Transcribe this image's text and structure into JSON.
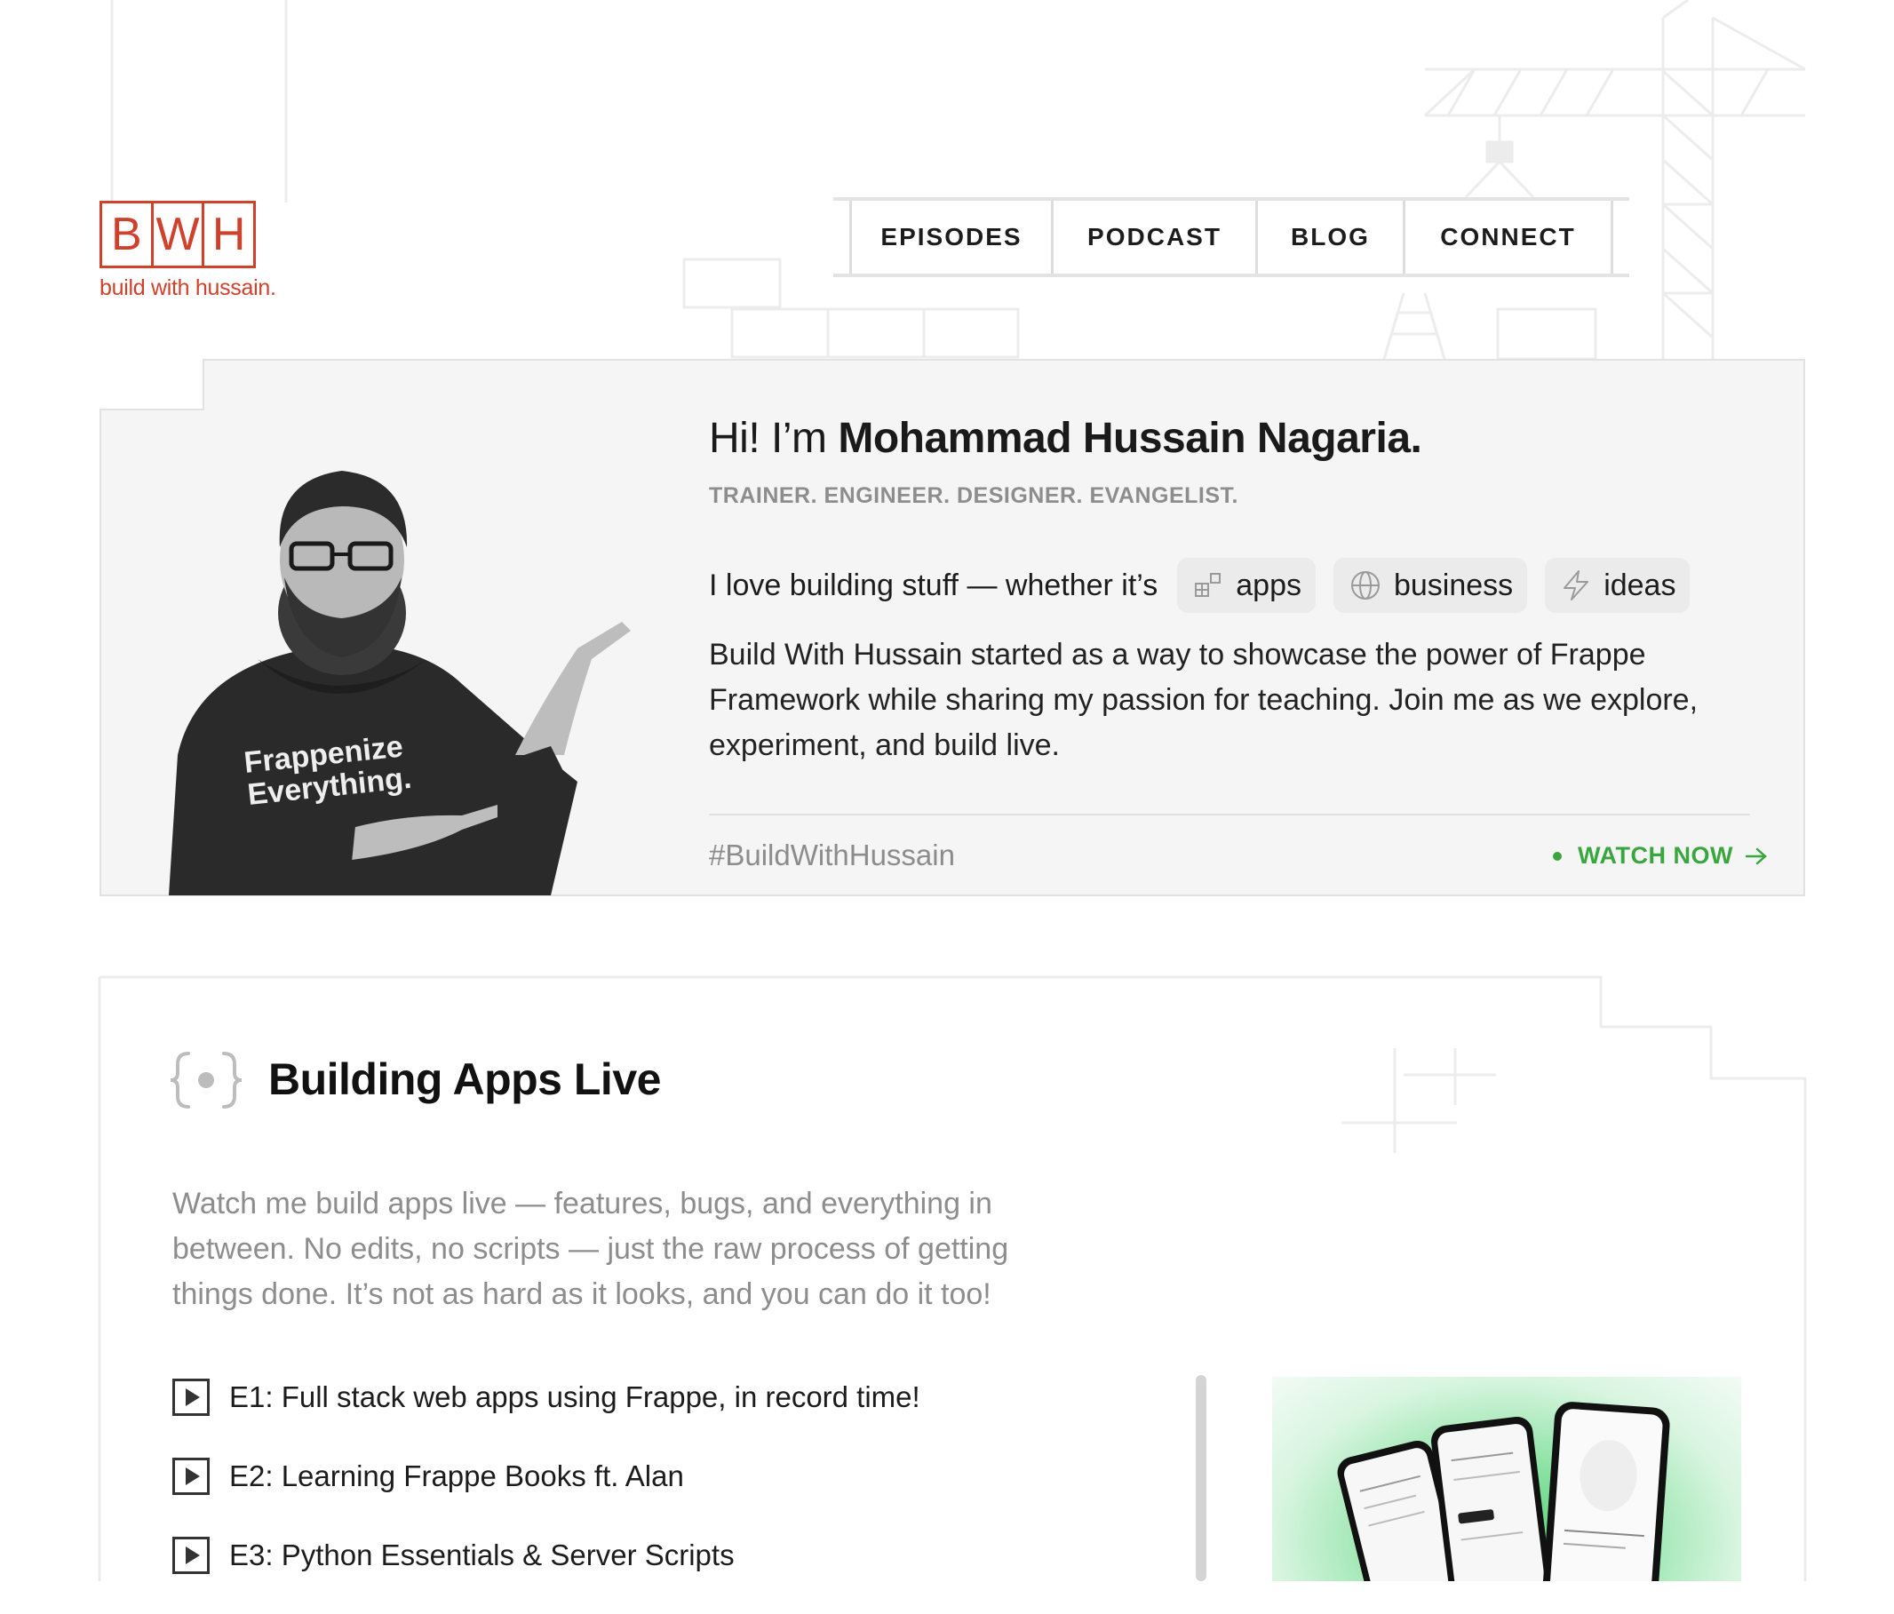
{
  "logo": {
    "letters": [
      "B",
      "W",
      "H"
    ],
    "tagline": "build with hussain."
  },
  "nav": {
    "items": [
      {
        "label": "EPISODES"
      },
      {
        "label": "PODCAST"
      },
      {
        "label": "BLOG"
      },
      {
        "label": "CONNECT"
      }
    ]
  },
  "hero": {
    "greeting_prefix": "Hi! I’m ",
    "name": "Mohammad Hussain Nagaria.",
    "roles": "TRAINER. ENGINEER. DESIGNER. EVANGELIST.",
    "love_text": "I love building stuff — whether it’s",
    "chips": [
      {
        "label": "apps",
        "icon": "apps-icon"
      },
      {
        "label": "business",
        "icon": "globe-icon"
      },
      {
        "label": "ideas",
        "icon": "lightning-icon"
      }
    ],
    "bio": "Build With Hussain started as a way to showcase the power of Frappe Framework while sharing my passion for teaching. Join me as we explore, experiment, and build live.",
    "hashtag": "#BuildWithHussain",
    "cta": "WATCH NOW",
    "cta_color": "#3aa63e",
    "portrait_shirt_text": [
      "Frappenize",
      "Everything."
    ]
  },
  "section": {
    "title": "Building Apps Live",
    "description": "Watch me build apps live — features, bugs, and everything in between. No edits, no scripts — just the raw process of getting things done. It’s not as hard as it looks, and you can do it too!",
    "episodes": [
      {
        "label": "E1: Full stack web apps using Frappe, in record time!"
      },
      {
        "label": "E2: Learning Frappe Books ft. Alan"
      },
      {
        "label": "E3: Python Essentials & Server Scripts"
      }
    ]
  },
  "colors": {
    "brand": "#d0412b",
    "accent": "#3aa63e"
  }
}
